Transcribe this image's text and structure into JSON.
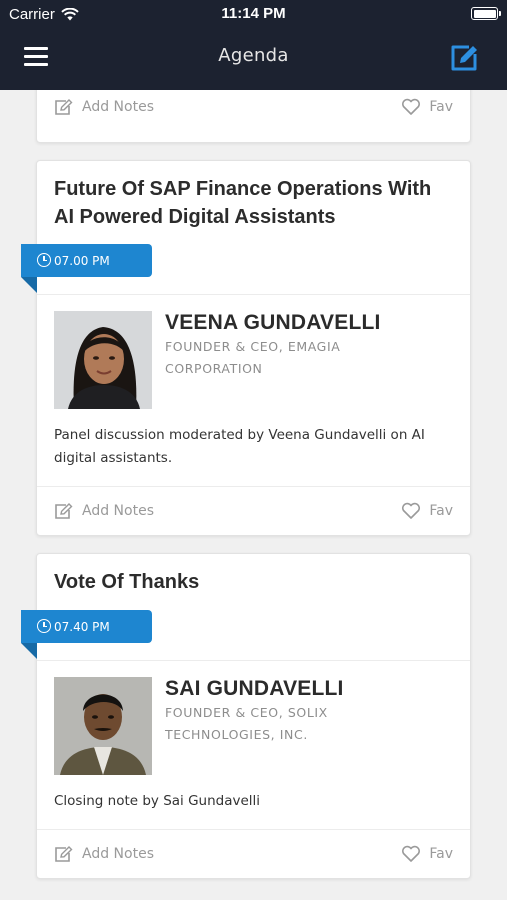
{
  "status_bar": {
    "carrier": "Carrier",
    "time": "11:14 PM"
  },
  "nav": {
    "title": "Agenda"
  },
  "actions": {
    "notes_label": "Add Notes",
    "fav_label": "Fav"
  },
  "sessions": [
    {
      "title": "Future Of SAP Finance Operations With AI Powered Digital Assistants",
      "time": "07.00 PM",
      "speaker": {
        "name": "VEENA GUNDAVELLI",
        "role": "FOUNDER & CEO, EMAGIA CORPORATION"
      },
      "description": "Panel discussion moderated by Veena Gundavelli on AI digital assistants."
    },
    {
      "title": "Vote Of Thanks",
      "time": "07.40 PM",
      "speaker": {
        "name": "SAI GUNDAVELLI",
        "role": "FOUNDER & CEO, SOLIX TECHNOLOGIES, INC."
      },
      "description": "Closing note by Sai Gundavelli"
    }
  ],
  "colors": {
    "nav_bg": "#1c2230",
    "accent": "#1e86d0",
    "icon_blue": "#2d8fe0"
  }
}
